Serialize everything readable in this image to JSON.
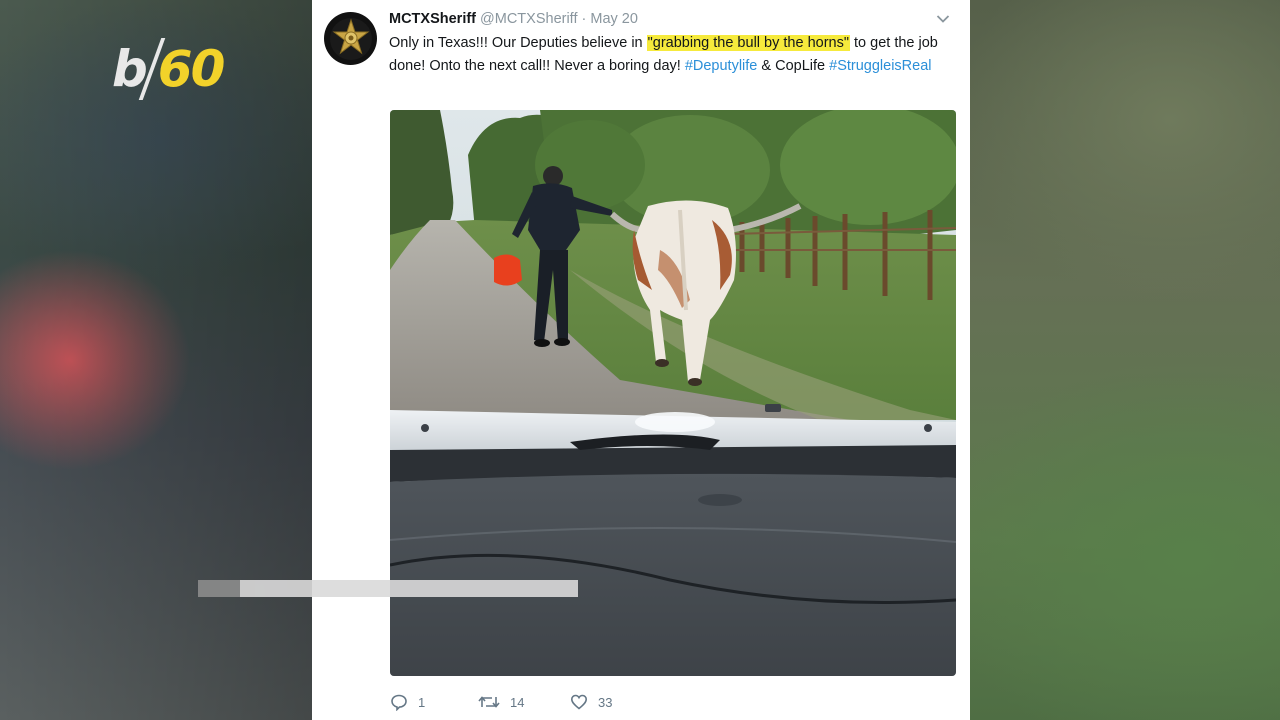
{
  "logo": {
    "text_b": "b",
    "text_num": "60"
  },
  "tweet": {
    "display_name": "MCTXSheriff",
    "handle": "@MCTXSheriff",
    "separator": "·",
    "date": "May 20",
    "text": {
      "part1": "Only in Texas!!! Our Deputies believe in ",
      "highlight": "\"grabbing the bull by the horns\"",
      "part2": " to get the job done! Onto the next call!! Never a boring day! ",
      "hashtag1": "#Deputylife",
      "part3": " & CopLife ",
      "hashtag2": "#StruggleisReal"
    },
    "actions": {
      "reply_count": "1",
      "retweet_count": "14",
      "like_count": "33"
    }
  },
  "colors": {
    "link": "#2b8fd8",
    "highlight": "#f6ea3c",
    "muted": "#8a969e",
    "logo_accent": "#f2d22a"
  },
  "icons": [
    "sheriff-badge-icon",
    "chevron-down-icon",
    "reply-icon",
    "retweet-icon",
    "like-icon"
  ]
}
